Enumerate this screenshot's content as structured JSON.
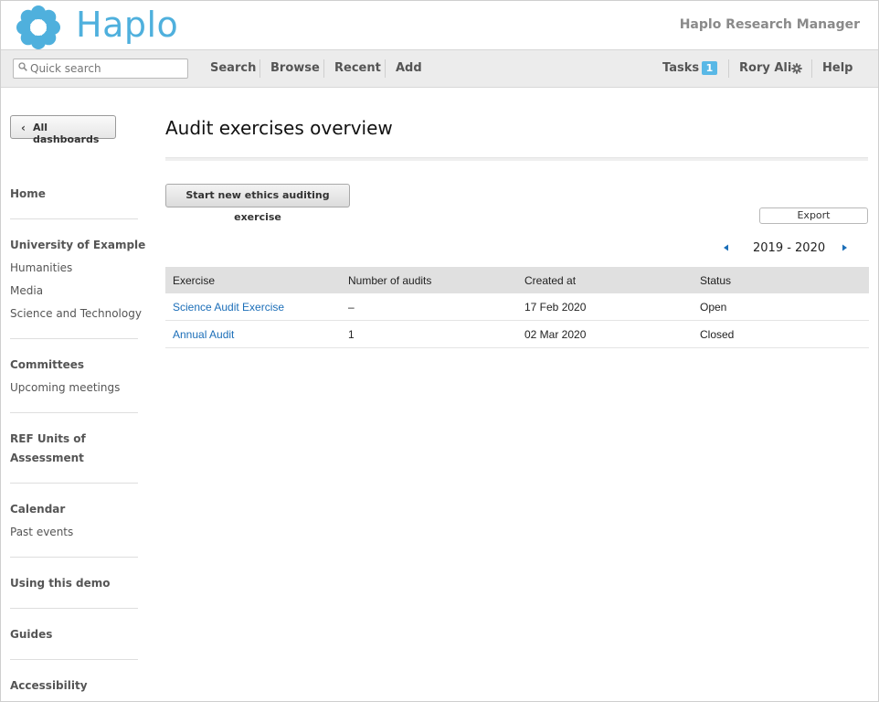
{
  "header": {
    "logo_text": "Haplo",
    "app_name": "Haplo Research Manager",
    "brand_color": "#4fb0dd"
  },
  "toolbar": {
    "search_placeholder": "Quick search",
    "nav": [
      "Search",
      "Browse",
      "Recent",
      "Add"
    ],
    "tasks_label": "Tasks",
    "tasks_count": "1",
    "user_name": "Rory Ali",
    "help_label": "Help"
  },
  "sidebar": {
    "all_dashboards": "All dashboards",
    "home": "Home",
    "university": "University of Example",
    "university_links": [
      "Humanities",
      "Media",
      "Science and Technology"
    ],
    "committees": "Committees",
    "committees_links": [
      "Upcoming meetings"
    ],
    "ref_units_line1": "REF Units of",
    "ref_units_line2": "Assessment",
    "calendar": "Calendar",
    "calendar_links": [
      "Past events"
    ],
    "using_demo": "Using this demo",
    "guides": "Guides",
    "accessibility": "Accessibility"
  },
  "main": {
    "title": "Audit exercises overview",
    "start_button": "Start new ethics auditing exercise",
    "export_button": "Export",
    "year_label": "2019 - 2020",
    "table": {
      "headers": [
        "Exercise",
        "Number of audits",
        "Created at",
        "Status"
      ],
      "rows": [
        {
          "exercise": "Science Audit Exercise",
          "audits": "–",
          "created": "17 Feb 2020",
          "status": "Open"
        },
        {
          "exercise": "Annual Audit",
          "audits": "1",
          "created": "02 Mar 2020",
          "status": "Closed"
        }
      ]
    }
  },
  "icons": {
    "logo": "haplo-flower-logo",
    "search": "search-icon",
    "gear": "gear-icon",
    "prev": "triangle-left-icon",
    "next": "triangle-right-icon",
    "back": "chevron-left-icon"
  }
}
